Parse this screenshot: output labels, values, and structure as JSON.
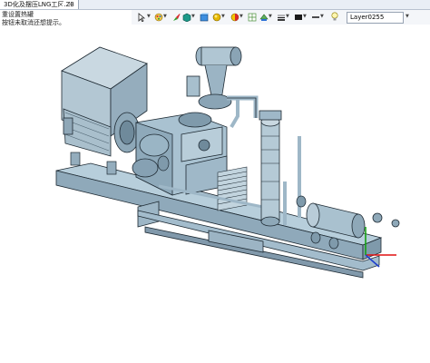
{
  "tab": {
    "title": "3D化及摆压LNG工厂.Z3",
    "close": "×",
    "new_tab": "+"
  },
  "messages": [
    "重设置热罐",
    "按钮未取消还想提示。"
  ],
  "toolbar": {
    "icons": [
      "cursor-icon",
      "color-palette-icon",
      "brush-icon",
      "box-icon",
      "cube-view-icon",
      "sphere-icon",
      "render-mode-icon",
      "grid-icon",
      "section-icon",
      "line-style-icon",
      "color-swatch-icon",
      "light-bulb-icon"
    ],
    "layer_value": "Layer0255",
    "accent_colors": {
      "yellow": "#f5c400",
      "green": "#2fa12f",
      "blue": "#2a6fd6",
      "red": "#d8292b",
      "gray": "#6d7580"
    }
  },
  "model": {
    "colors": {
      "body": "#aec7d6",
      "shadow": "#7f9aab",
      "dark": "#5e7585",
      "edge": "#1e2a33",
      "motor": "#b9c9d3"
    },
    "axis_colors": {
      "x": "#e01010",
      "y": "#15a015",
      "z": "#1f3fcf"
    }
  }
}
